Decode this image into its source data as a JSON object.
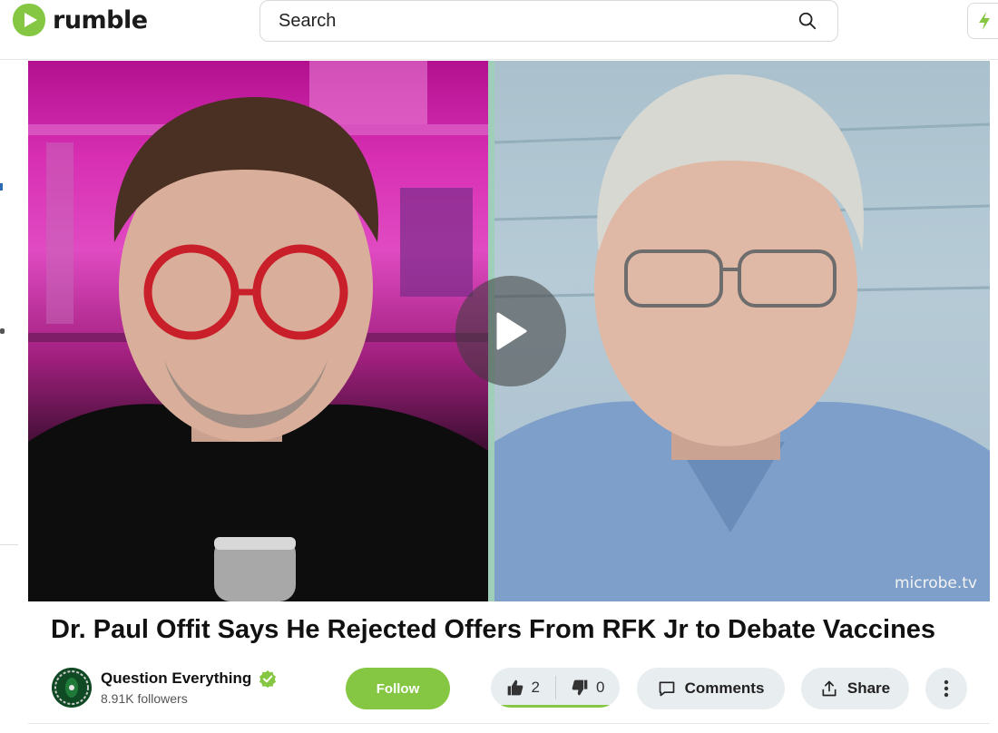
{
  "header": {
    "logo_text": "rumble",
    "search": {
      "placeholder": "Search"
    }
  },
  "video": {
    "watermark": "microbe.tv"
  },
  "title": "Dr. Paul Offit Says He Rejected Offers From RFK Jr to Debate Vaccines",
  "channel": {
    "name": "Question Everything",
    "followers": "8.91K followers",
    "verified": true
  },
  "actions": {
    "follow_label": "Follow",
    "likes": "2",
    "dislikes": "0",
    "comments_label": "Comments",
    "share_label": "Share"
  },
  "colors": {
    "brand": "#85c742",
    "pill_bg": "#e8edf0"
  },
  "icons": [
    "rumble-logo-icon",
    "search-icon",
    "bolt-icon",
    "play-icon",
    "verified-icon",
    "thumbs-up-icon",
    "thumbs-down-icon",
    "comment-icon",
    "share-icon",
    "more-vertical-icon"
  ]
}
